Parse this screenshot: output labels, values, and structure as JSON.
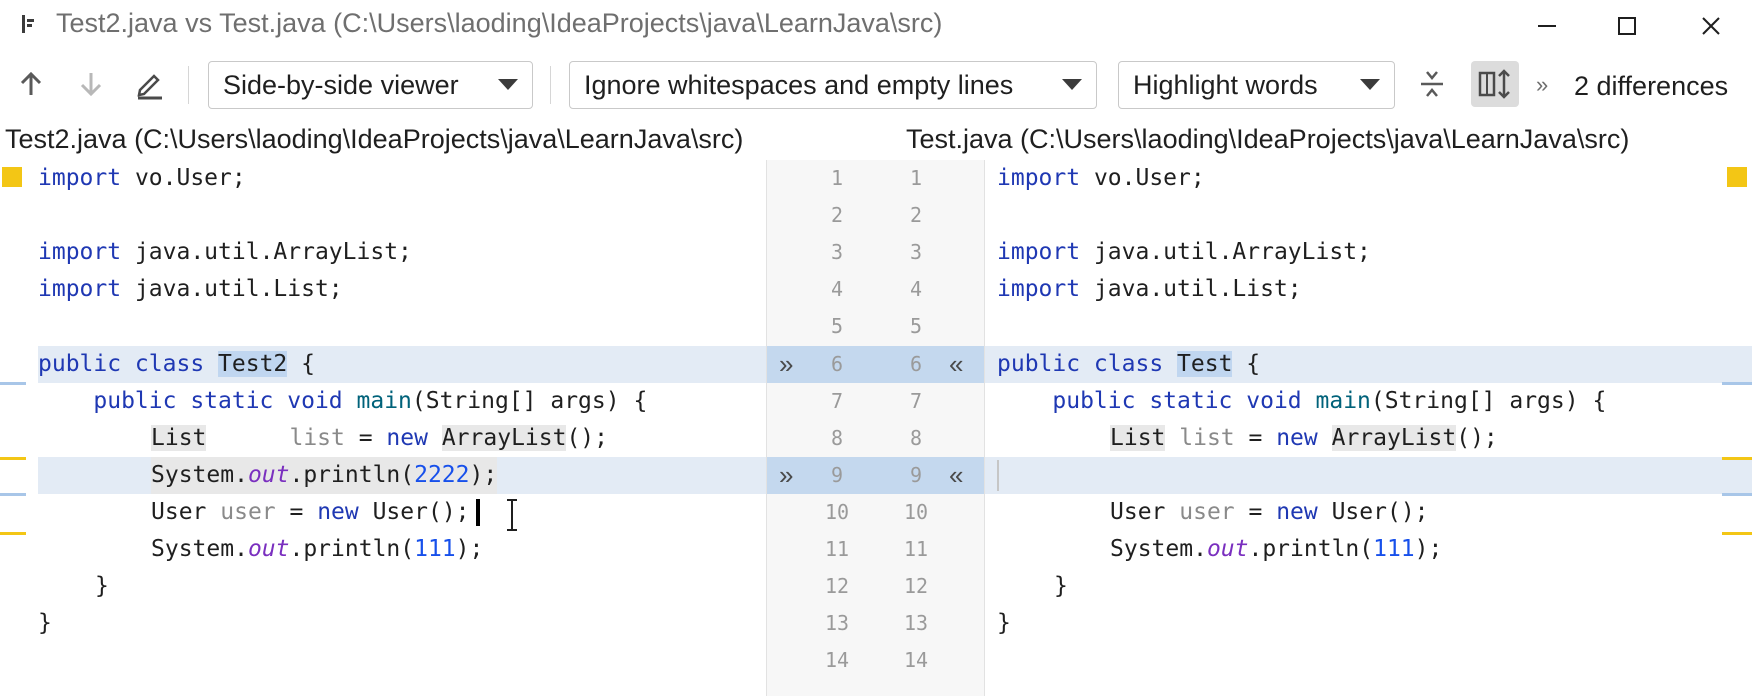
{
  "window": {
    "title": "Test2.java vs Test.java (C:\\Users\\laoding\\IdeaProjects\\java\\LearnJava\\src)"
  },
  "toolbar": {
    "viewer_mode": "Side-by-side viewer",
    "whitespace_mode": "Ignore whitespaces and empty lines",
    "highlight_mode": "Highlight words",
    "more_label": "»",
    "differences_count": "2 differences"
  },
  "left_file": {
    "header": "Test2.java (C:\\Users\\laoding\\IdeaProjects\\java\\LearnJava\\src)"
  },
  "right_file": {
    "header": "Test.java (C:\\Users\\laoding\\IdeaProjects\\java\\LearnJava\\src)"
  },
  "line_numbers": [
    "1",
    "2",
    "3",
    "4",
    "5",
    "6",
    "7",
    "8",
    "9",
    "10",
    "11",
    "12",
    "13",
    "14"
  ],
  "gutter": {
    "apply_left_arrow": "»",
    "apply_right_arrow": "«"
  },
  "left_code": {
    "l1_kw": "import",
    "l1_rest": " vo.User;",
    "l3_kw": "import",
    "l3_rest": " java.util.ArrayList;",
    "l4_kw": "import",
    "l4_rest": " java.util.List;",
    "l6_kw": "public class",
    "l6_sp": " ",
    "l6_name": "Test2",
    "l6_rest": " {",
    "l7_kw": "    public static void",
    "l7_sp": " ",
    "l7_fn": "main",
    "l7_rest": "(String[] args) {",
    "l8_type": "List",
    "l8_pad": "      ",
    "l8_var": "list",
    "l8_eq": " = ",
    "l8_new": "new",
    "l8_sp": " ",
    "l8_cls": "ArrayList",
    "l8_rest": "();",
    "l9_a": "System.",
    "l9_fld": "out",
    "l9_b": ".println(",
    "l9_num": "2222",
    "l9_c": ");",
    "l10_a": "User ",
    "l10_var": "user",
    "l10_eq": " = ",
    "l10_new": "new",
    "l10_rest": " User();",
    "l11_a": "System.",
    "l11_fld": "out",
    "l11_b": ".println(",
    "l11_num": "111",
    "l11_c": ");",
    "l12": "}",
    "l13": "}"
  },
  "right_code": {
    "l1_kw": "import",
    "l1_rest": " vo.User;",
    "l3_kw": "import",
    "l3_rest": " java.util.ArrayList;",
    "l4_kw": "import",
    "l4_rest": " java.util.List;",
    "l6_kw": "public class",
    "l6_sp": " ",
    "l6_name": "Test",
    "l6_rest": " {",
    "l7_kw": "    public static void",
    "l7_sp": " ",
    "l7_fn": "main",
    "l7_rest": "(String[] args) {",
    "l8_type": "List",
    "l8_sp1": " ",
    "l8_var": "list",
    "l8_eq": " = ",
    "l8_new": "new",
    "l8_sp": " ",
    "l8_cls": "ArrayList",
    "l8_rest": "();",
    "l10_a": "User ",
    "l10_var": "user",
    "l10_eq": " = ",
    "l10_new": "new",
    "l10_rest": " User();",
    "l11_a": "System.",
    "l11_fld": "out",
    "l11_b": ".println(",
    "l11_num": "111",
    "l11_c": ");",
    "l12": "}",
    "l13": "}"
  },
  "colors": {
    "keyword": "#1f38b3",
    "number": "#1750eb",
    "changed_row": "#e3ebf5",
    "changed_word": "#c0d6f0",
    "change_marker": "#f3c615"
  },
  "icons": [
    "app-icon",
    "minimize-icon",
    "maximize-icon",
    "close-icon",
    "prev-difference-icon",
    "next-difference-icon",
    "edit-source-icon",
    "collapse-unchanged-icon",
    "sync-scroll-icon",
    "more-actions-icon",
    "apply-left-icon",
    "apply-right-icon",
    "text-cursor-icon"
  ]
}
